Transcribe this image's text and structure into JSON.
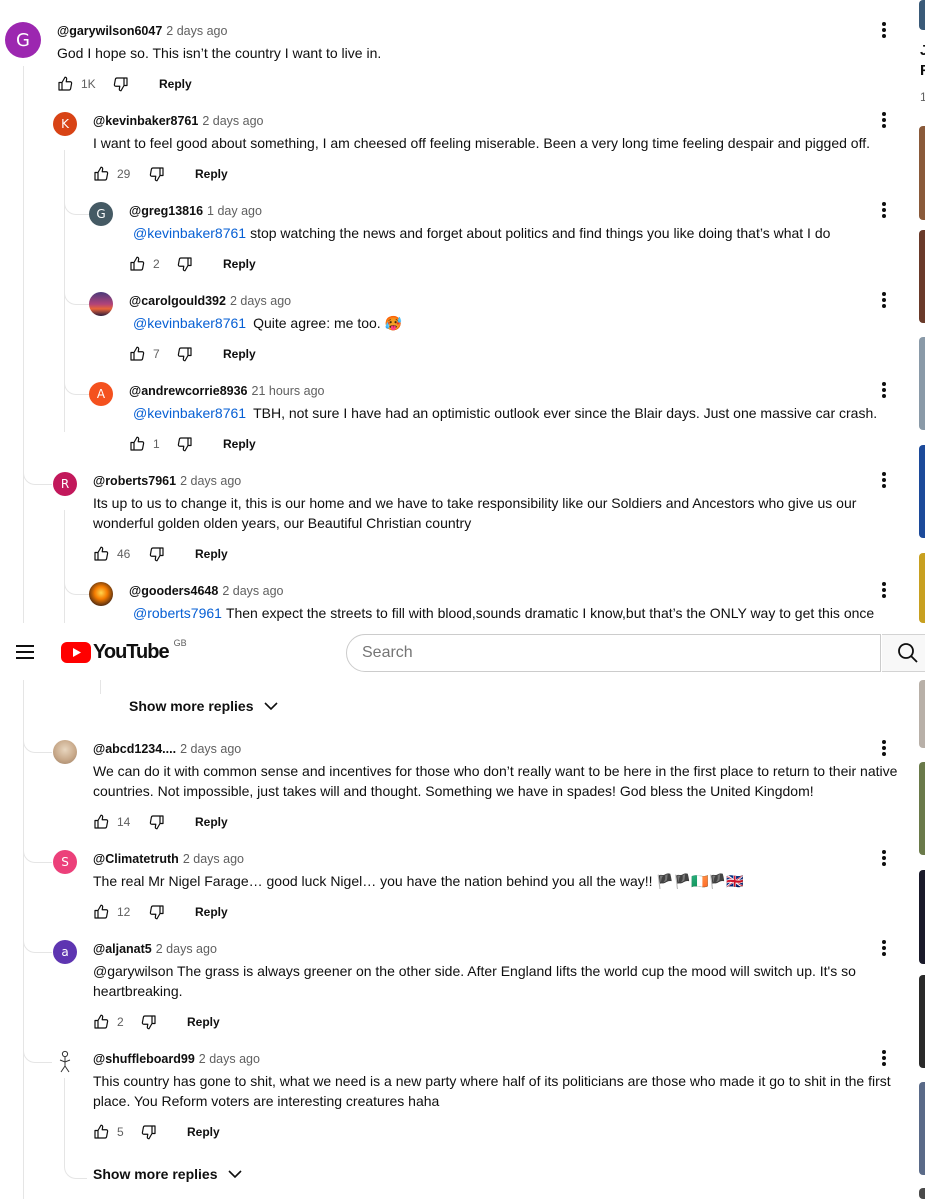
{
  "masthead": {
    "logo_text": "YouTube",
    "region": "GB",
    "search_placeholder": "Search"
  },
  "sidebar_fragments": {
    "line1": "J",
    "line2": "F",
    "line3": "1"
  },
  "comments": [
    {
      "handle": "@garywilson6047",
      "time": "2 days ago",
      "text": "God I hope so. This isn’t the country I want to live in.",
      "likes": "1K",
      "reply_label": "Reply",
      "avatar_letter": "G"
    },
    {
      "handle": "@kevinbaker8761",
      "time": "2 days ago",
      "text": "I want to feel good about something, I am cheesed off feeling miserable. Been a very long time feeling despair and pigged off.",
      "likes": "29",
      "reply_label": "Reply",
      "avatar_letter": "K"
    },
    {
      "handle": "@greg13816",
      "time": "1 day ago",
      "mention": "@kevinbaker8761",
      "text": "stop watching the news and forget about politics and find things you like doing that’s what I do",
      "likes": "2",
      "reply_label": "Reply",
      "avatar_letter": "G"
    },
    {
      "handle": "@carolgould392",
      "time": "2 days ago",
      "mention": "@kevinbaker8761",
      "text": "Quite agree: me too. 🥵",
      "likes": "7",
      "reply_label": "Reply"
    },
    {
      "handle": "@andrewcorrie8936",
      "time": "21 hours ago",
      "mention": "@kevinbaker8761",
      "text": "TBH, not sure I have had an optimistic outlook ever since the Blair days. Just one massive car crash.",
      "likes": "1",
      "reply_label": "Reply",
      "avatar_letter": "A"
    },
    {
      "handle": "@roberts7961",
      "time": "2 days ago",
      "text": "Its up to us to change it, this is our home and we have to take responsibility like our Soldiers and Ancestors who give us our wonderful golden olden years, our Beautiful Christian country",
      "likes": "46",
      "reply_label": "Reply",
      "avatar_letter": "R"
    },
    {
      "handle": "@gooders4648",
      "time": "2 days ago",
      "mention": "@roberts7961",
      "text": "Then expect the streets to fill with blood,sounds dramatic I know,but that’s the ONLY way to get this once"
    },
    {
      "handle": "@abcd1234....",
      "time": "2 days ago",
      "text": "We can do it with common sense and incentives for those who don’t really want to be here in the first place to return to their native countries. Not impossible, just takes will and thought. Something we have in spades! God bless the United Kingdom!",
      "likes": "14",
      "reply_label": "Reply"
    },
    {
      "handle": "@Climatetruth",
      "time": "2 days ago",
      "text": "The real Mr Nigel Farage… good luck Nigel… you have the nation behind you all the way!! 🏴🏴🇮🇪🏴🇬🇧",
      "likes": "12",
      "reply_label": "Reply",
      "avatar_letter": "S"
    },
    {
      "handle": "@aljanat5",
      "time": "2 days ago",
      "text": "@garywilson The grass is always greener on the other side. After England lifts the world cup the mood will switch up. It's so heartbreaking.",
      "likes": "2",
      "reply_label": "Reply",
      "avatar_letter": "a"
    },
    {
      "handle": "@shuffleboard99",
      "time": "2 days ago",
      "text": "This country has gone to shit, what we need is a new party where half of its politicians are those who made it go to shit in the first place. You Reform voters are interesting creatures haha",
      "likes": "5",
      "reply_label": "Reply"
    }
  ],
  "show_more_replies": [
    "Show more replies",
    "Show more replies"
  ],
  "colors": {
    "avatar_g": "#9c27b0",
    "avatar_k": "#d84315",
    "avatar_g2": "#455a64",
    "avatar_a": "#f4511e",
    "avatar_r": "#c2185b",
    "avatar_s": "#ec407a",
    "avatar_a2": "#5e35b1",
    "mention": "#065fd4",
    "youtube_red": "#ff0000"
  }
}
